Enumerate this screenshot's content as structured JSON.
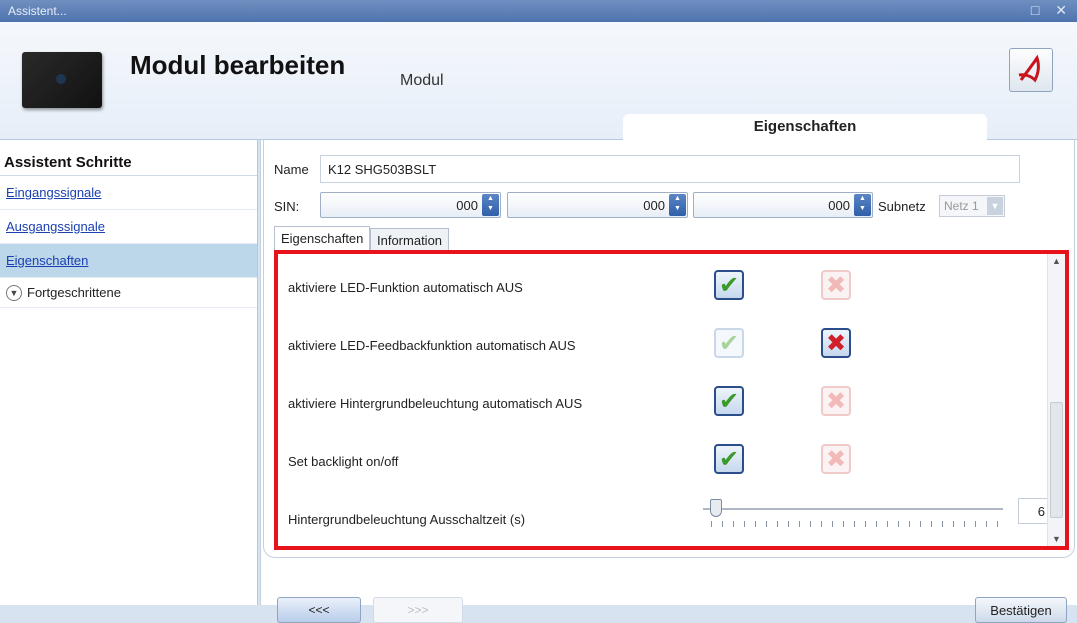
{
  "window": {
    "title": "Assistent...",
    "controls": "□ ✕"
  },
  "header": {
    "title": "Modul bearbeiten",
    "subtitle": "Modul",
    "tab": "Eigenschaften"
  },
  "sidebar": {
    "heading": "Assistent Schritte",
    "items": [
      {
        "label": "Eingangssignale",
        "active": false
      },
      {
        "label": "Ausgangssignale",
        "active": false
      },
      {
        "label": "Eigenschaften",
        "active": true
      }
    ],
    "advanced": "Fortgeschrittene"
  },
  "form": {
    "name_label": "Name",
    "name_value": "K12 SHG503BSLT",
    "sin_label": "SIN:",
    "sin_values": [
      "000",
      "000",
      "000"
    ],
    "subnet_label": "Subnetz",
    "subnet_value": "Netz 1",
    "tabs": [
      "Eigenschaften",
      "Information"
    ]
  },
  "settings": [
    {
      "label": "aktiviere LED-Funktion automatisch AUS",
      "enabled": true
    },
    {
      "label": "aktiviere LED-Feedbackfunktion automatisch AUS",
      "enabled": false
    },
    {
      "label": "aktiviere Hintergrundbeleuchtung automatisch AUS",
      "enabled": true
    },
    {
      "label": "Set backlight on/off",
      "enabled": true
    }
  ],
  "slider": {
    "label": "Hintergrundbeleuchtung Ausschaltzeit (s)",
    "value": "6"
  },
  "buttons": {
    "prev": "<<<",
    "next": ">>>",
    "confirm": "Bestätigen"
  },
  "colors": {
    "highlight_box": "#e8121c",
    "check": "#3a9a2a",
    "cross": "#d0202a"
  }
}
